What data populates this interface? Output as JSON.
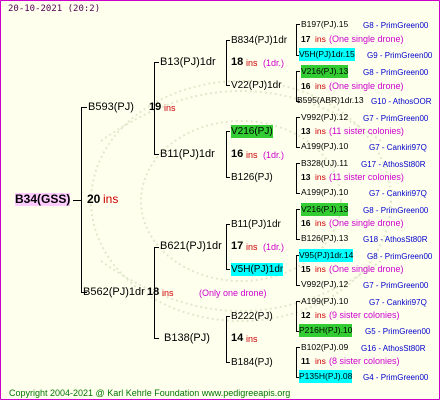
{
  "header": {
    "date": "20-10-2021 (20:2)"
  },
  "footer": {
    "copyright": "Copyright 2004-2021 @ Karl Kehrle Foundation  www.pedigreeapis.org"
  },
  "root": {
    "name": "B34(GSS)",
    "value": "20",
    "unit": "ins"
  },
  "gen1": [
    {
      "name": "B593(PJ)",
      "value": "19",
      "unit": "ins"
    },
    {
      "name": "B562(PJ)1dr",
      "value": "18",
      "unit": "ins",
      "note": "(Only one drone)"
    }
  ],
  "gen2": [
    {
      "name": "B13(PJ)1dr",
      "value": "18",
      "unit": "ins",
      "note": "(1dr.)"
    },
    {
      "name": "B11(PJ)1dr",
      "value": "16",
      "unit": "ins",
      "note": "(1dr.)"
    },
    {
      "name": "B621(PJ)1dr",
      "value": "17",
      "unit": "ins",
      "note": "(1dr.)"
    },
    {
      "name": "B138(PJ)",
      "value": "14",
      "unit": "ins"
    }
  ],
  "gen3": [
    {
      "name": "B834(PJ)1dr"
    },
    {
      "name": "V22(PJ)1dr"
    },
    {
      "name": "V216(PJ)"
    },
    {
      "name": "B126(PJ)"
    },
    {
      "name": "B11(PJ)1dr"
    },
    {
      "name": "V5H(PJ)1dr"
    },
    {
      "name": "B222(PJ)"
    },
    {
      "name": "B184(PJ)"
    }
  ],
  "gen4": [
    {
      "top": "B197(PJ).15",
      "top_src": "G8 - PrimGreen00",
      "mid_val": "17",
      "mid_unit": "ins",
      "mid_note": "(One single drone)",
      "bot": "V5H(PJ)1dr.15",
      "bot_src": "G9 - PrimGreen00"
    },
    {
      "top": "V216(PJ).13",
      "top_src": "G8 - PrimGreen00",
      "mid_val": "16",
      "mid_unit": "ins",
      "mid_note": "(One single drone)",
      "bot": "B595(ABR)1dr.13",
      "bot_src": "G10 - AthosOOR"
    },
    {
      "top": "V992(PJ).12",
      "top_src": "G7 - PrimGreen00",
      "mid_val": "13",
      "mid_unit": "ins",
      "mid_note": "(11 sister colonies)",
      "bot": "A199(PJ).10",
      "bot_src": "G7 - Cankiri97Q"
    },
    {
      "top": "B328(UJ).11",
      "top_src": "G17 - AthosSt80R",
      "mid_val": "13",
      "mid_unit": "ins",
      "mid_note": "(11 sister colonies)",
      "bot": "A199(PJ).10",
      "bot_src": "G7 - Cankiri97Q"
    },
    {
      "top": "V216(PJ).13",
      "top_src": "G8 - PrimGreen00",
      "mid_val": "16",
      "mid_unit": "ins",
      "mid_note": "(One single drone)",
      "bot": "B126(PJ).13",
      "bot_src": "G18 - AthosSt80R"
    },
    {
      "top": "V95(PJ)1dr.14",
      "top_src": "G8 - PrimGreen00",
      "mid_val": "15",
      "mid_unit": "ins",
      "mid_note": "(One single drone)",
      "bot": "V992(PJ).12",
      "bot_src": "G7 - PrimGreen00"
    },
    {
      "top": "A199(PJ).10",
      "top_src": "G7 - Cankiri97Q",
      "mid_val": "12",
      "mid_unit": "ins",
      "mid_note": "(9 sister colonies)",
      "bot": "P216H(PJ).10",
      "bot_src": "G5 - PrimGreen00"
    },
    {
      "top": "B102(PJ).09",
      "top_src": "G16 - AthosSt80R",
      "mid_val": "11",
      "mid_unit": "ins",
      "mid_note": "(8 sister colonies)",
      "bot": "P135H(PJ).08",
      "bot_src": "G4 - PrimGreen00"
    }
  ],
  "colors": {
    "border": "#cc00cc",
    "background": "#ffffee",
    "ins": "#cc0000",
    "note": "#cc00cc",
    "source": "#0000cc",
    "highlight_green": "#33cc33",
    "highlight_cyan": "#00ffff",
    "root_bg": "#ffccff"
  }
}
